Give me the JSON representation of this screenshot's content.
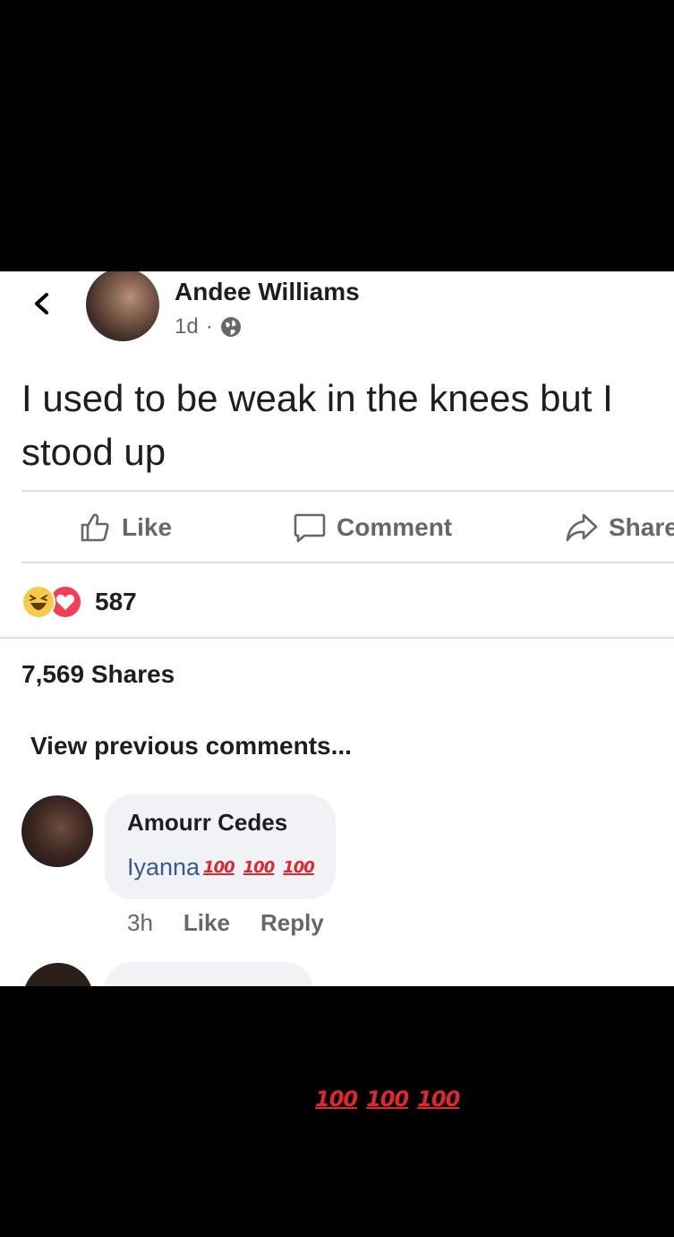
{
  "post": {
    "author": "Andee Williams",
    "time": "1d",
    "separator": "·",
    "privacy_icon": "globe-icon",
    "text": "I used to be weak in the knees but I stood up"
  },
  "actions": {
    "like": "Like",
    "comment": "Comment",
    "share": "Share"
  },
  "reactions": {
    "icons": [
      "haha-reaction-icon",
      "love-reaction-icon"
    ],
    "count": "587"
  },
  "shares": "7,569 Shares",
  "view_previous": "View previous comments...",
  "comments": [
    {
      "author": "Amourr Cedes",
      "mention": "Iyanna",
      "emoji": [
        "100",
        "100",
        "100"
      ],
      "time": "3h",
      "like": "Like",
      "reply": "Reply"
    }
  ],
  "caption": {
    "emoji": [
      "100",
      "100",
      "100"
    ]
  },
  "colors": {
    "background": "#000000",
    "card": "#ffffff",
    "text": "#1c1e21",
    "muted": "#65676b",
    "mention": "#385898",
    "emoji_red": "#e0262f"
  }
}
